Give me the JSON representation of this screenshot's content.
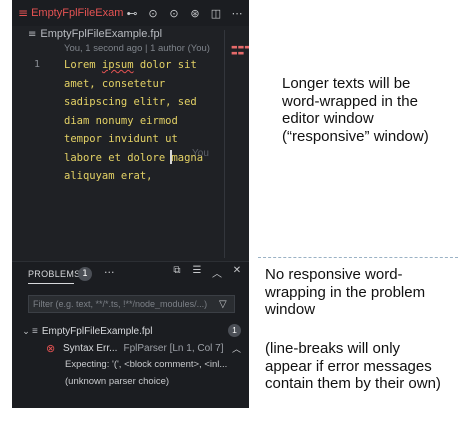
{
  "tab": {
    "title": "EmptyFplFileExam",
    "icon": "file-lines-icon"
  },
  "tab_actions": [
    "git-compare-icon",
    "circle-dot-icon",
    "arrow-circle-icon",
    "branch-icon",
    "split-editor-icon",
    "more-icon"
  ],
  "breadcrumb": {
    "label": "EmptyFplFileExample.fpl"
  },
  "blame": {
    "text": "You, 1 second ago | 1 author (You)"
  },
  "editor": {
    "line_number": "1",
    "lines": [
      "Lorem ipsum dolor sit",
      "amet, consetetur",
      "sadipscing elitr, sed",
      "diam nonumy eirmod",
      "tempor invidunt ut",
      "labore et dolore magna",
      "aliquyam erat,"
    ],
    "ghost_text": "You",
    "text_color": "#e3d165"
  },
  "panel": {
    "tab_label": "PROBLEMS",
    "count": "1",
    "more": "···",
    "actions": [
      "collapse-all-icon",
      "filter-list-icon",
      "chevron-up-icon",
      "close-icon"
    ],
    "filter_placeholder": "Filter (e.g. text, **/*.ts, !**/node_modules/...)"
  },
  "problems": {
    "file_name": "EmptyFplFileExample.fpl",
    "file_count": "1",
    "error_title": "Syntax Err...",
    "error_source": "FplParser [Ln 1, Col 7]",
    "detail_line1": "Expecting: '(', <block comment>, <inl...",
    "detail_line2": "(unknown parser choice)"
  },
  "annotations": {
    "top": [
      "Longer texts will be",
      "word-wrapped in the",
      "editor window",
      "(“responsive” window)"
    ],
    "bottom_a": [
      "No responsive word-",
      "wrapping in the problem",
      "window"
    ],
    "bottom_b": [
      "(line-breaks will only",
      "appear if error messages",
      "contain them by their own)"
    ]
  },
  "colors": {
    "error": "#e35252",
    "editor_bg": "#1f2125"
  }
}
